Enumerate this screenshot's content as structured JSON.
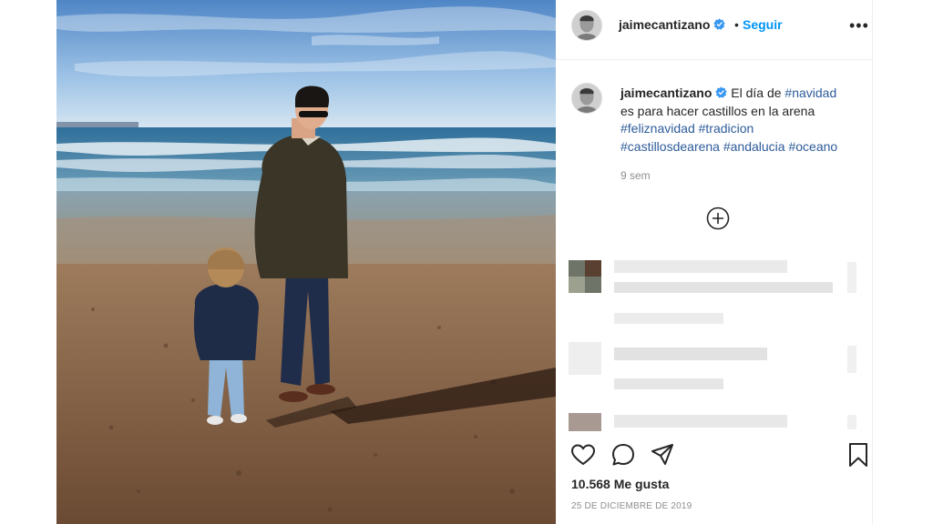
{
  "post": {
    "username": "jaimecantizano",
    "follow_label": "Seguir",
    "separator": "•",
    "more_label": "•••"
  },
  "caption": {
    "username": "jaimecantizano",
    "text_1": "El día de ",
    "tag_navidad": "#navidad",
    "text_2": "es para hacer castillos en la arena",
    "tags_line_1": [
      "#feliznavidad",
      "#tradicion"
    ],
    "tags_line_2": [
      "#castillosdearena",
      "#andalucia",
      "#oceano"
    ],
    "time_ago": "9 sem"
  },
  "footer": {
    "likes": "10.568 Me gusta",
    "date": "25 DE DICIEMBRE DE 2019"
  },
  "colors": {
    "link": "#0095f6",
    "hashtag": "#2d5b9a",
    "muted": "#8e8e8e",
    "verified": "#3897f0"
  },
  "icons": [
    "verified-badge-icon",
    "more-options-icon",
    "load-more-plus-icon",
    "heart-icon",
    "comment-icon",
    "share-icon",
    "bookmark-icon"
  ]
}
